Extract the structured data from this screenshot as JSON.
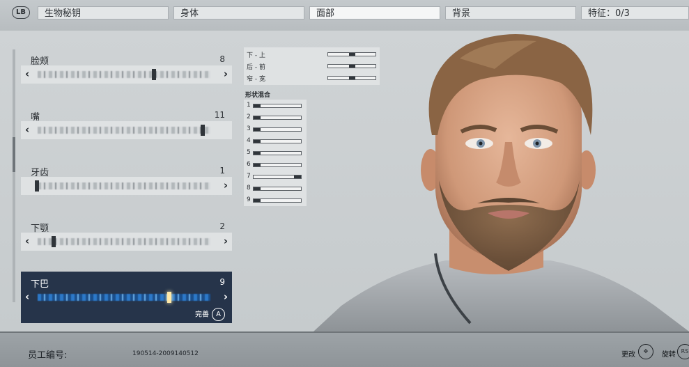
{
  "top": {
    "lb_button": "LB",
    "tabs": [
      {
        "label": "生物秘钥"
      },
      {
        "label": "身体"
      },
      {
        "label": "面部"
      },
      {
        "label": "背景"
      },
      {
        "label": "特征：0/3"
      }
    ]
  },
  "features": [
    {
      "label": "脸颊",
      "value": "8"
    },
    {
      "label": "嘴",
      "value": "11"
    },
    {
      "label": "牙齿",
      "value": "1"
    },
    {
      "label": "下颚",
      "value": "2"
    },
    {
      "label": "下巴",
      "value": "9"
    }
  ],
  "selected_confirm": {
    "label": "完善",
    "button": "A"
  },
  "position_adjust": [
    {
      "label": "下 - 上"
    },
    {
      "label": "后 - 前"
    },
    {
      "label": "窄 - 宽"
    }
  ],
  "shape_blend": {
    "title": "形状混合",
    "rows": [
      {
        "label": "1"
      },
      {
        "label": "2"
      },
      {
        "label": "3"
      },
      {
        "label": "4"
      },
      {
        "label": "5"
      },
      {
        "label": "6"
      },
      {
        "label": "7"
      },
      {
        "label": "8"
      },
      {
        "label": "9"
      }
    ]
  },
  "bottom": {
    "employee_label": "员工编号:",
    "employee_id": "190514-2009140512",
    "hint_change": "更改",
    "hint_rotate": "旋转",
    "rotate_button": "RS"
  },
  "colors": {
    "selected_bg": "#26344a",
    "selected_knob": "#ffe9a8",
    "barcode_blue": "#2c78c8"
  }
}
